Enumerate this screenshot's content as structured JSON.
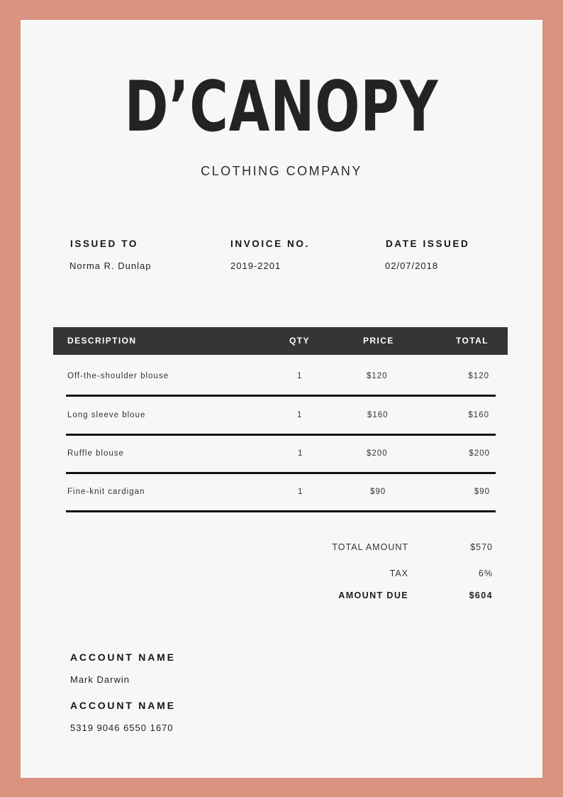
{
  "brand": {
    "name": "D’CANOPY",
    "tagline": "CLOTHING COMPANY"
  },
  "meta": {
    "issued_to": {
      "label": "ISSUED TO",
      "value": "Norma R. Dunlap"
    },
    "invoice_no": {
      "label": "INVOICE NO.",
      "value": "2019-2201"
    },
    "date_issued": {
      "label": "DATE ISSUED",
      "value": "02/07/2018"
    }
  },
  "table": {
    "headers": {
      "description": "DESCRIPTION",
      "qty": "QTY",
      "price": "PRICE",
      "total": "TOTAL"
    },
    "rows": [
      {
        "description": "Off-the-shoulder blouse",
        "qty": "1",
        "price": "$120",
        "total": "$120"
      },
      {
        "description": "Long sleeve bloue",
        "qty": "1",
        "price": "$160",
        "total": "$160"
      },
      {
        "description": "Ruffle blouse",
        "qty": "1",
        "price": "$200",
        "total": "$200"
      },
      {
        "description": "Fine-knit cardigan",
        "qty": "1",
        "price": "$90",
        "total": "$90"
      }
    ]
  },
  "summary": {
    "total_amount": {
      "label": "TOTAL AMOUNT",
      "value": "$570"
    },
    "tax": {
      "label": "TAX",
      "value": "6%"
    },
    "amount_due": {
      "label": "AMOUNT DUE",
      "value": "$604"
    }
  },
  "account": {
    "name_label": "ACCOUNT NAME",
    "name_value": "Mark Darwin",
    "number_label": "ACCOUNT NAME",
    "number_value": "5319 9046 6550 1670"
  },
  "colors": {
    "frame": "#d9937f",
    "paper": "#f7f7f7",
    "header_bar": "#353535"
  }
}
